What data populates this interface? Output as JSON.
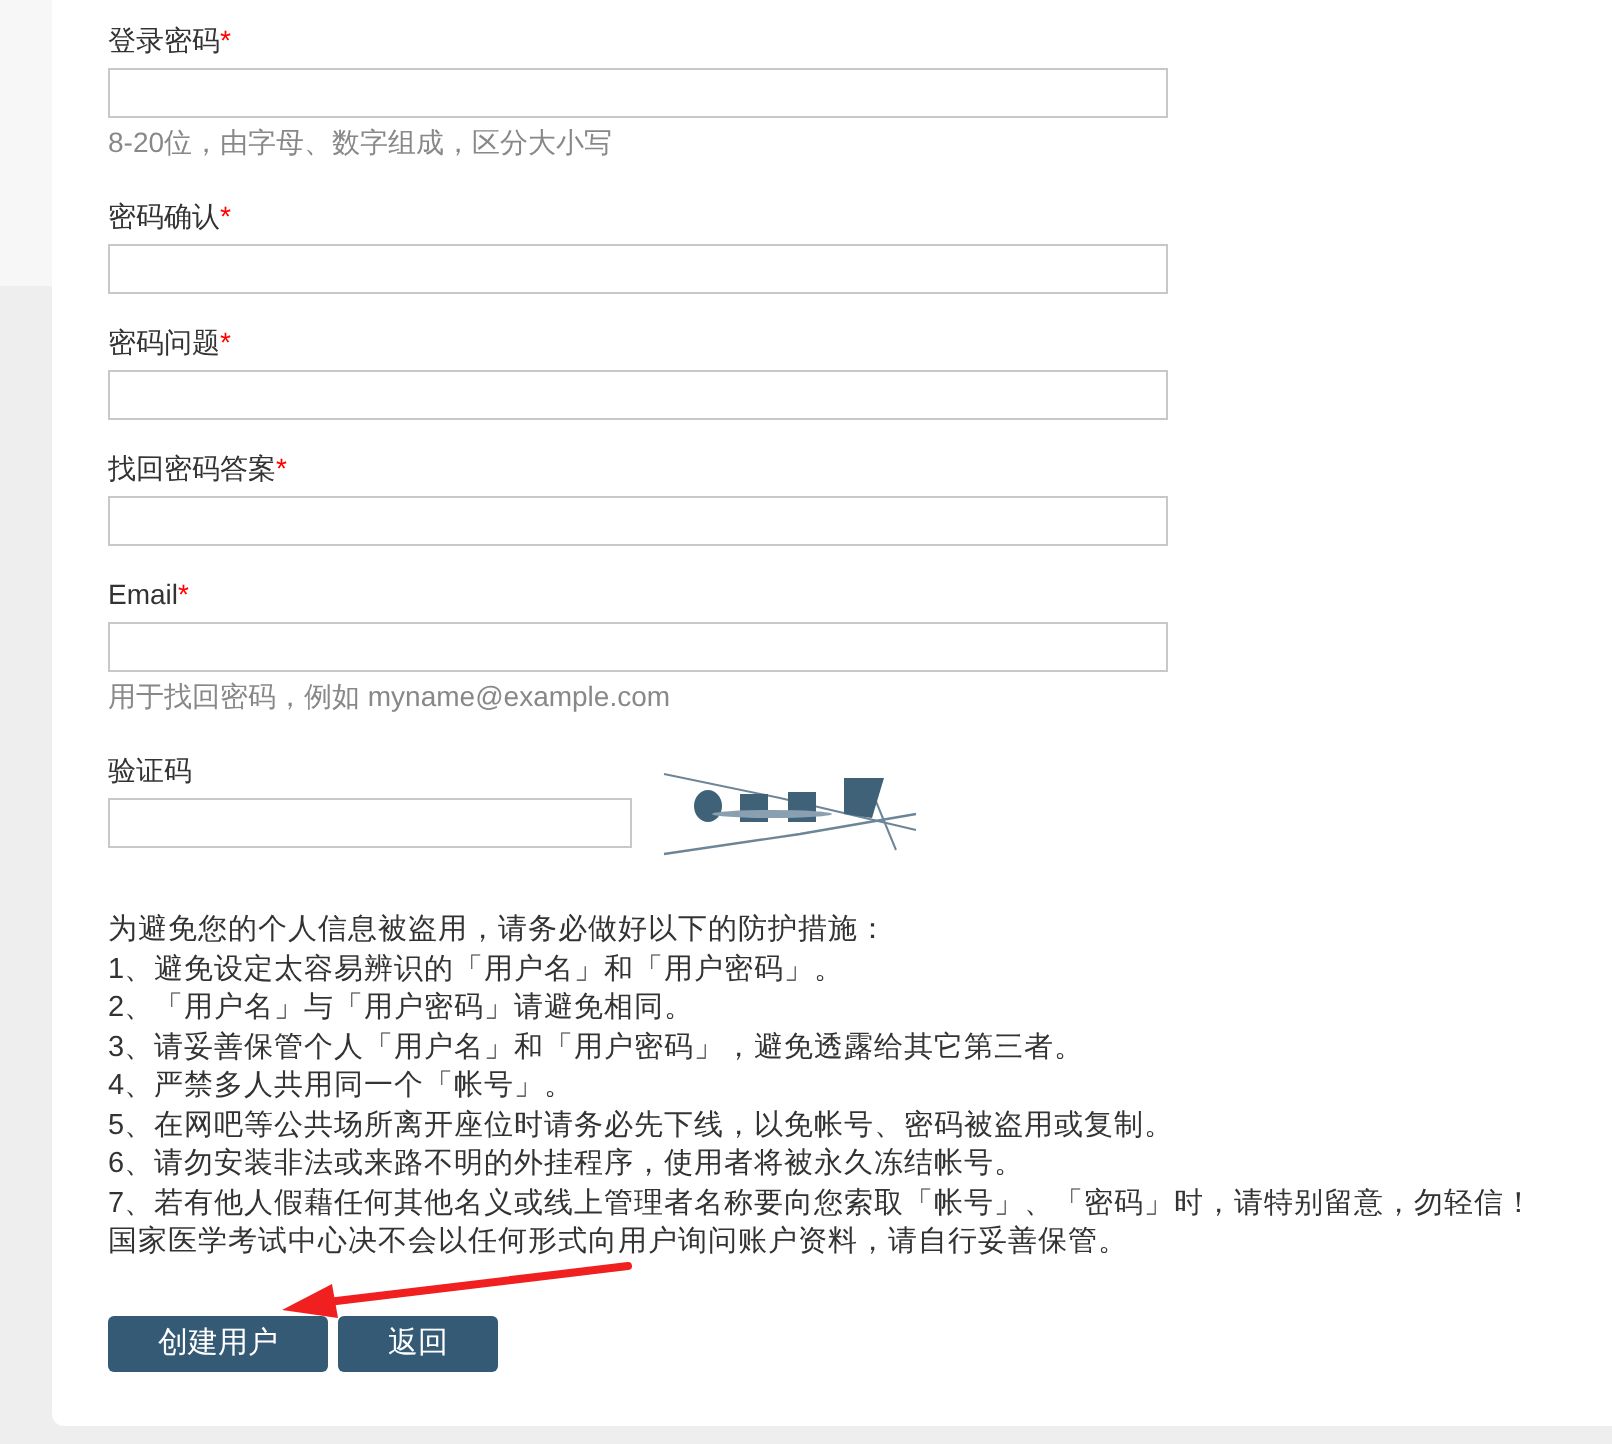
{
  "fields": [
    {
      "label": "登录密码",
      "required_mark": "*",
      "kind": "text",
      "hint": "8-20位，由字母、数字组成，区分大小写"
    },
    {
      "label": "密码确认",
      "required_mark": "*",
      "kind": "text"
    },
    {
      "label": "密码问题",
      "required_mark": "*",
      "kind": "text"
    },
    {
      "label": "找回密码答案",
      "required_mark": "*",
      "kind": "text"
    },
    {
      "label": "Email",
      "required_mark": "*",
      "kind": "text",
      "hint": "用于找回密码，例如 myname@example.com"
    },
    {
      "label": "验证码",
      "kind": "captcha"
    }
  ],
  "notice": [
    "为避免您的个人信息被盗用，请务必做好以下的防护措施：",
    "1、避免设定太容易辨识的「用户名」和「用户密码」。",
    "2、「用户名」与「用户密码」请避免相同。",
    "3、请妥善保管个人「用户名」和「用户密码」，避免透露给其它第三者。",
    "4、严禁多人共用同一个「帐号」。",
    "5、在网吧等公共场所离开座位时请务必先下线，以免帐号、密码被盗用或复制。",
    "6、请勿安装非法或来路不明的外挂程序，使用者将被永久冻结帐号。",
    "7、若有他人假藉任何其他名义或线上管理者名称要向您索取「帐号」、「密码」时，请特别留意，勿轻信！",
    "国家医学考试中心决不会以任何形式向用户询问账户资料，请自行妥善保管。"
  ],
  "buttons": [
    {
      "label": "创建用户"
    },
    {
      "label": "返回"
    }
  ]
}
